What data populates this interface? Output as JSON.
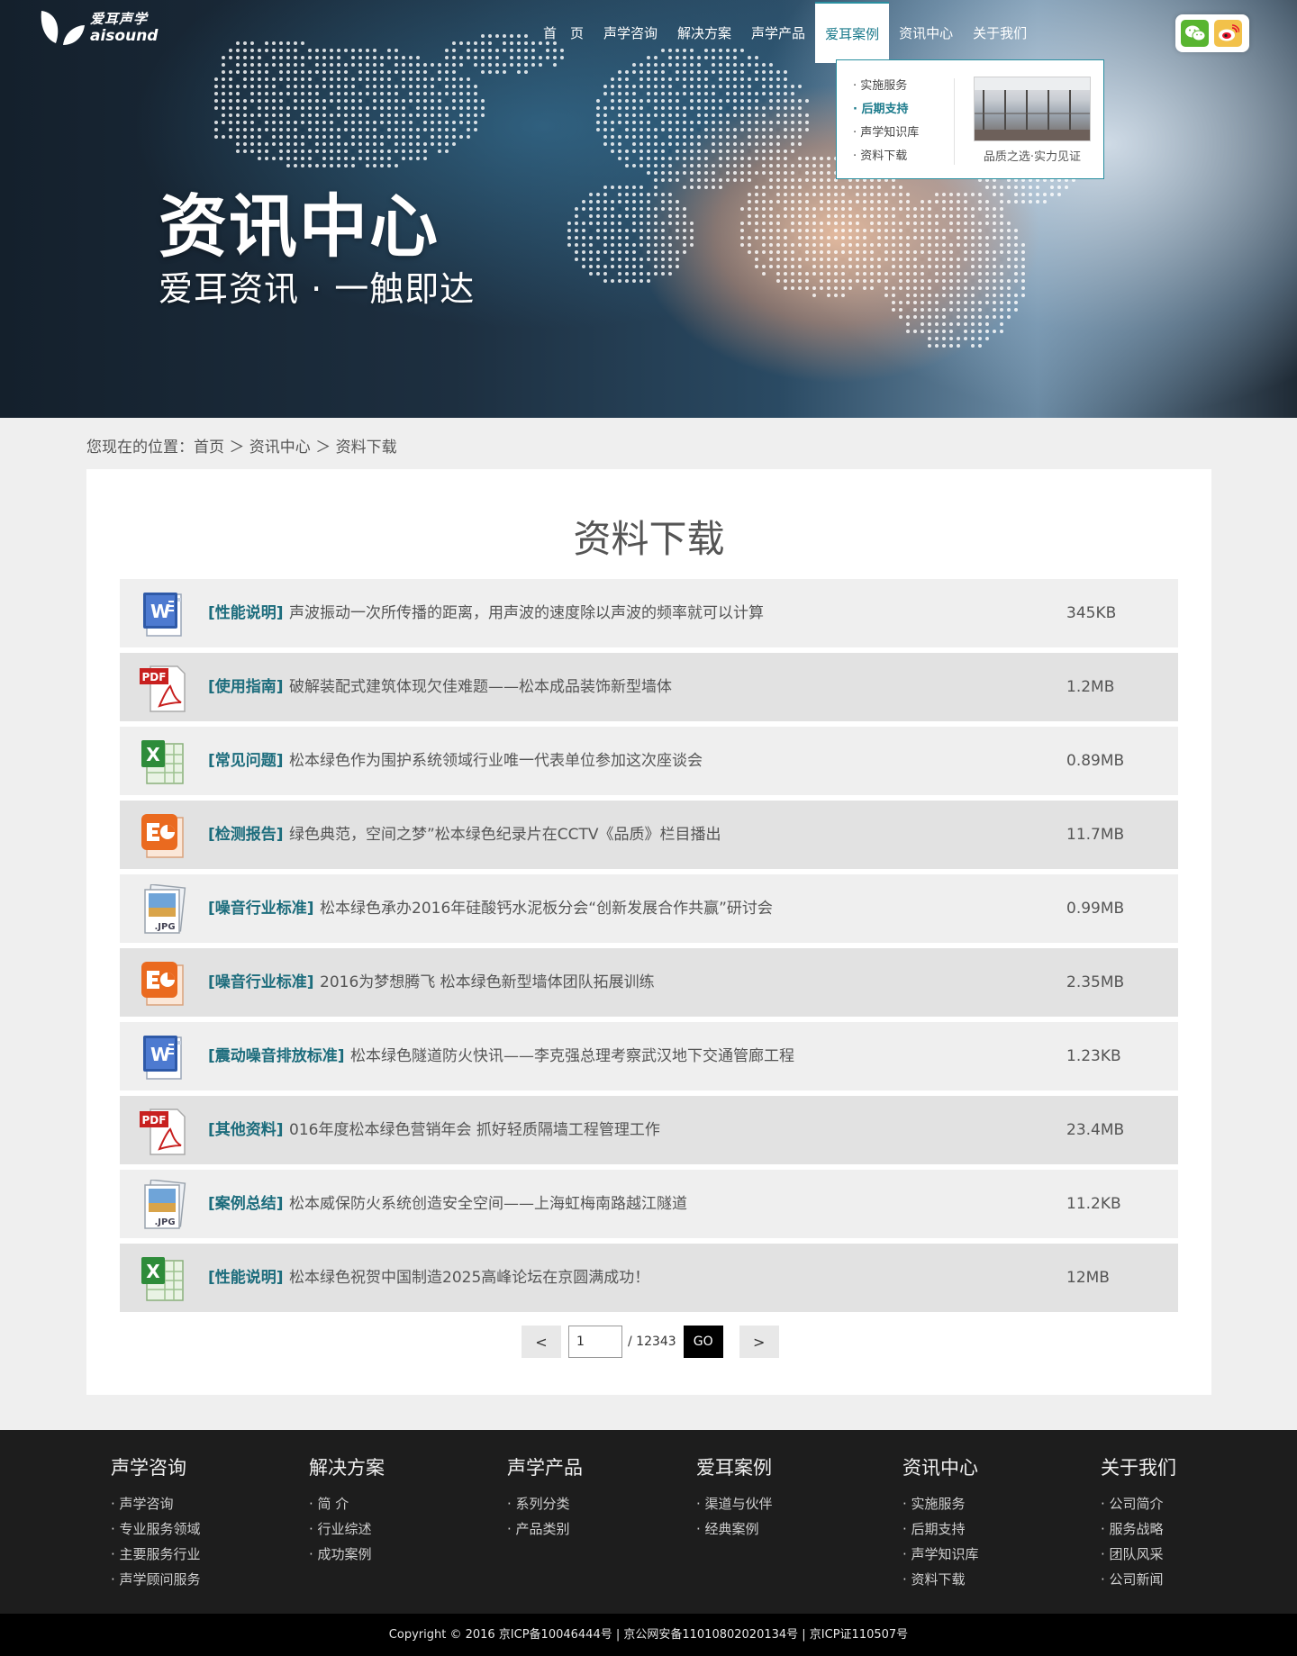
{
  "logo": {
    "name_cn": "爱耳声学",
    "name_en": "aisound"
  },
  "nav": [
    "首　页",
    "声学咨询",
    "解决方案",
    "声学产品",
    "爱耳案例",
    "资讯中心",
    "关于我们"
  ],
  "nav_active_index": 4,
  "social": [
    {
      "name": "wechat",
      "icon": "wechat-icon",
      "color": "#58b530"
    },
    {
      "name": "weibo",
      "icon": "weibo-icon",
      "color": "#f2c14a"
    }
  ],
  "dropdown": {
    "items": [
      "· 实施服务",
      "· 后期支持",
      "· 声学知识库",
      "· 资料下载"
    ],
    "active_index": 1,
    "caption": "品质之选·实力见证"
  },
  "hero": {
    "title": "资讯中心",
    "subtitle": "爱耳资讯 · 一触即达"
  },
  "breadcrumb": "您现在的位置：首页 ＞ 资讯中心 ＞ 资料下载",
  "main": {
    "title": "资料下载",
    "files": [
      {
        "type": "word",
        "category": "[性能说明]",
        "title": "声波振动一次所传播的距离，用声波的速度除以声波的频率就可以计算",
        "size": "345KB"
      },
      {
        "type": "pdf",
        "category": "[使用指南]",
        "title": "破解装配式建筑体现欠佳难题——松本成品装饰新型墙体",
        "size": "1.2MB"
      },
      {
        "type": "excel",
        "category": "[常见问题]",
        "title": "松本绿色作为围护系统领域行业唯一代表单位参加这次座谈会",
        "size": "0.89MB"
      },
      {
        "type": "ppt",
        "category": "[检测报告]",
        "title": "绿色典范，空间之梦”松本绿色纪录片在CCTV《品质》栏目播出",
        "size": "11.7MB"
      },
      {
        "type": "jpg",
        "category": "[噪音行业标准]",
        "title": "松本绿色承办2016年硅酸钙水泥板分会“创新发展合作共赢”研讨会",
        "size": "0.99MB"
      },
      {
        "type": "ppt",
        "category": "[噪音行业标准]",
        "title": "2016为梦想腾飞 松本绿色新型墙体团队拓展训练",
        "size": "2.35MB"
      },
      {
        "type": "word",
        "category": "[震动噪音排放标准]",
        "title": "松本绿色隧道防火快讯——李克强总理考察武汉地下交通管廊工程",
        "size": "1.23KB"
      },
      {
        "type": "pdf",
        "category": "[其他资料]",
        "title": "016年度松本绿色营销年会 抓好轻质隔墙工程管理工作",
        "size": "23.4MB"
      },
      {
        "type": "jpg",
        "category": "[案例总结]",
        "title": "松本威保防火系统创造安全空间——上海虹梅南路越江隧道",
        "size": "11.2KB"
      },
      {
        "type": "excel",
        "category": "[性能说明]",
        "title": "松本绿色祝贺中国制造2025高峰论坛在京圆满成功！",
        "size": "12MB"
      }
    ]
  },
  "pager": {
    "prev": "<",
    "next": ">",
    "current": "1",
    "total": "/ 12343",
    "go": "GO"
  },
  "footer": {
    "columns": [
      {
        "title": "声学咨询",
        "items": [
          "· 声学咨询",
          "· 专业服务领域",
          "· 主要服务行业",
          "· 声学顾问服务"
        ]
      },
      {
        "title": "解决方案",
        "items": [
          "· 简 介",
          "· 行业综述",
          "· 成功案例"
        ]
      },
      {
        "title": "声学产品",
        "items": [
          "· 系列分类",
          "· 产品类别"
        ]
      },
      {
        "title": "爱耳案例",
        "items": [
          "· 渠道与伙伴",
          "· 经典案例"
        ]
      },
      {
        "title": "资讯中心",
        "items": [
          "· 实施服务",
          "· 后期支持",
          "· 声学知识库",
          "· 资料下载"
        ]
      },
      {
        "title": "关于我们",
        "items": [
          "· 公司简介",
          "· 服务战略",
          "· 团队风采",
          "· 公司新闻"
        ]
      }
    ],
    "copyright": "Copyright © 2016  京ICP备10046444号 | 京公网安备11010802020134号 | 京ICP证110507号"
  },
  "colors": {
    "accent": "#1c7b8c",
    "category": "#1c6c7c",
    "footer_bg": "#1d1d1d"
  }
}
